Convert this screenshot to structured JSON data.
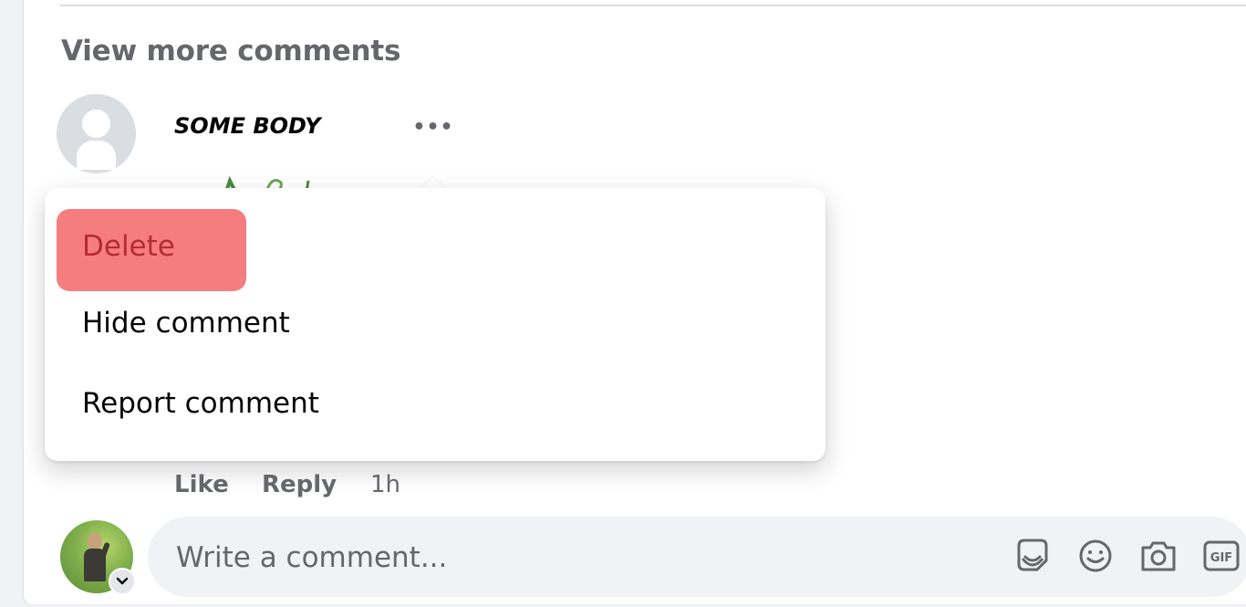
{
  "comments": {
    "view_more": "View more comments",
    "author": "SOME BODY",
    "more_options": "•••",
    "actions": {
      "like": "Like",
      "reply": "Reply",
      "time": "1h"
    }
  },
  "context_menu": {
    "items": [
      {
        "label": "Delete",
        "highlighted": true
      },
      {
        "label": "Hide comment"
      },
      {
        "label": "Report comment"
      }
    ]
  },
  "composer": {
    "placeholder": "Write a comment...",
    "icons": [
      "sticker-icon",
      "emoji-icon",
      "camera-icon",
      "gif-icon"
    ],
    "gif_label": "GIF"
  },
  "colors": {
    "delete_highlight": "#f67d7f",
    "delete_text": "#b52b32",
    "secondary_text": "#65676b",
    "composer_bg": "#f0f2f5"
  }
}
